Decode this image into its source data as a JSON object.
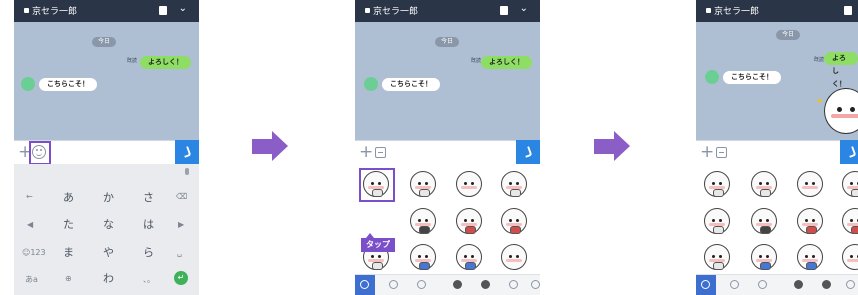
{
  "chat_title": "京セラ一郎",
  "date_label": "今日",
  "read_label": "既読",
  "messages": {
    "sent": "よろしく！",
    "received": "こちらこそ！"
  },
  "tap_label": "タップ",
  "keyboard": {
    "rows": [
      {
        "left": "←",
        "keys": [
          "あ",
          "か",
          "さ"
        ],
        "right": "⌫"
      },
      {
        "left": "◀",
        "keys": [
          "た",
          "な",
          "は"
        ],
        "right": "▶"
      },
      {
        "left": "☺123",
        "keys": [
          "ま",
          "や",
          "ら"
        ],
        "right": "␣"
      },
      {
        "left": "あa",
        "keys": [
          "⊕",
          "わ",
          "、。"
        ],
        "right": "↵"
      }
    ]
  },
  "colors": {
    "status_bar": "#2b3548",
    "chat_bg": "#aebfd3",
    "sent_bubble": "#8edd65",
    "send_button": "#2b86e3",
    "highlight": "#7b4fc9",
    "arrow": "#8a5ec6"
  },
  "icons": {
    "lock": "lock-icon",
    "notebook": "notebook-icon",
    "chevron": "chevron-down-icon",
    "plus": "plus-icon",
    "emoji": "emoji-icon",
    "sticker": "sticker-icon",
    "send": "phone-icon",
    "mic": "mic-icon"
  }
}
